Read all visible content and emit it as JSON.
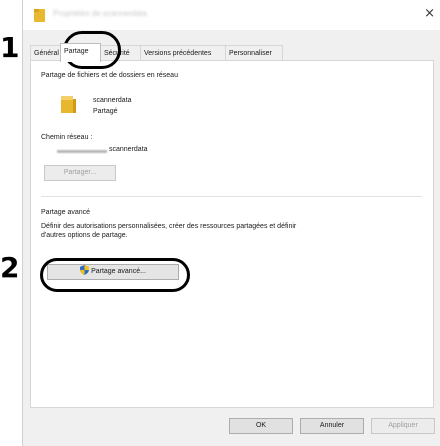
{
  "callouts": {
    "step1": "1",
    "step2": "2"
  },
  "window": {
    "title": "Propriétés de scannerdata",
    "close_glyph": "×"
  },
  "tabs": [
    {
      "label": "Général"
    },
    {
      "label": "Partage"
    },
    {
      "label": "Sécurité"
    },
    {
      "label": "Versions précédentes"
    },
    {
      "label": "Personnaliser"
    }
  ],
  "network_share": {
    "heading": "Partage de fichiers et de dossiers en réseau",
    "folder_name": "scannerdata",
    "status": "Partagé",
    "path_label": "Chemin réseau :",
    "path_value": "scannerdata",
    "share_button": "Partager..."
  },
  "advanced": {
    "heading": "Partage avancé",
    "description_line1": "Définir des autorisations personnalisées, créer des ressources partagées et définir",
    "description_line2": "d'autres options de partage.",
    "button": "Partage avancé..."
  },
  "footer": {
    "ok": "OK",
    "cancel": "Annuler",
    "apply": "Appliquer"
  },
  "icons": {
    "folder": "folder-icon",
    "shield": "shield-icon",
    "close": "close-icon"
  },
  "colors": {
    "folder": "#e9b62f",
    "shield_blue": "#2d6cc0",
    "shield_yellow": "#f2c21b"
  }
}
